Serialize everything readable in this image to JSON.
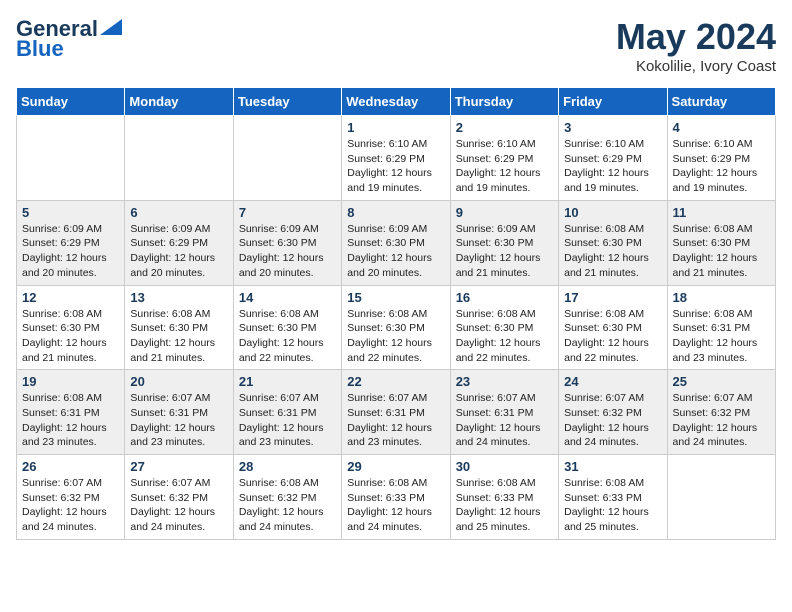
{
  "header": {
    "logo_line1": "General",
    "logo_line2": "Blue",
    "month": "May 2024",
    "location": "Kokolilie, Ivory Coast"
  },
  "weekdays": [
    "Sunday",
    "Monday",
    "Tuesday",
    "Wednesday",
    "Thursday",
    "Friday",
    "Saturday"
  ],
  "weeks": [
    [
      {
        "day": "",
        "info": ""
      },
      {
        "day": "",
        "info": ""
      },
      {
        "day": "",
        "info": ""
      },
      {
        "day": "1",
        "info": "Sunrise: 6:10 AM\nSunset: 6:29 PM\nDaylight: 12 hours and 19 minutes."
      },
      {
        "day": "2",
        "info": "Sunrise: 6:10 AM\nSunset: 6:29 PM\nDaylight: 12 hours and 19 minutes."
      },
      {
        "day": "3",
        "info": "Sunrise: 6:10 AM\nSunset: 6:29 PM\nDaylight: 12 hours and 19 minutes."
      },
      {
        "day": "4",
        "info": "Sunrise: 6:10 AM\nSunset: 6:29 PM\nDaylight: 12 hours and 19 minutes."
      }
    ],
    [
      {
        "day": "5",
        "info": "Sunrise: 6:09 AM\nSunset: 6:29 PM\nDaylight: 12 hours and 20 minutes."
      },
      {
        "day": "6",
        "info": "Sunrise: 6:09 AM\nSunset: 6:29 PM\nDaylight: 12 hours and 20 minutes."
      },
      {
        "day": "7",
        "info": "Sunrise: 6:09 AM\nSunset: 6:30 PM\nDaylight: 12 hours and 20 minutes."
      },
      {
        "day": "8",
        "info": "Sunrise: 6:09 AM\nSunset: 6:30 PM\nDaylight: 12 hours and 20 minutes."
      },
      {
        "day": "9",
        "info": "Sunrise: 6:09 AM\nSunset: 6:30 PM\nDaylight: 12 hours and 21 minutes."
      },
      {
        "day": "10",
        "info": "Sunrise: 6:08 AM\nSunset: 6:30 PM\nDaylight: 12 hours and 21 minutes."
      },
      {
        "day": "11",
        "info": "Sunrise: 6:08 AM\nSunset: 6:30 PM\nDaylight: 12 hours and 21 minutes."
      }
    ],
    [
      {
        "day": "12",
        "info": "Sunrise: 6:08 AM\nSunset: 6:30 PM\nDaylight: 12 hours and 21 minutes."
      },
      {
        "day": "13",
        "info": "Sunrise: 6:08 AM\nSunset: 6:30 PM\nDaylight: 12 hours and 21 minutes."
      },
      {
        "day": "14",
        "info": "Sunrise: 6:08 AM\nSunset: 6:30 PM\nDaylight: 12 hours and 22 minutes."
      },
      {
        "day": "15",
        "info": "Sunrise: 6:08 AM\nSunset: 6:30 PM\nDaylight: 12 hours and 22 minutes."
      },
      {
        "day": "16",
        "info": "Sunrise: 6:08 AM\nSunset: 6:30 PM\nDaylight: 12 hours and 22 minutes."
      },
      {
        "day": "17",
        "info": "Sunrise: 6:08 AM\nSunset: 6:30 PM\nDaylight: 12 hours and 22 minutes."
      },
      {
        "day": "18",
        "info": "Sunrise: 6:08 AM\nSunset: 6:31 PM\nDaylight: 12 hours and 23 minutes."
      }
    ],
    [
      {
        "day": "19",
        "info": "Sunrise: 6:08 AM\nSunset: 6:31 PM\nDaylight: 12 hours and 23 minutes."
      },
      {
        "day": "20",
        "info": "Sunrise: 6:07 AM\nSunset: 6:31 PM\nDaylight: 12 hours and 23 minutes."
      },
      {
        "day": "21",
        "info": "Sunrise: 6:07 AM\nSunset: 6:31 PM\nDaylight: 12 hours and 23 minutes."
      },
      {
        "day": "22",
        "info": "Sunrise: 6:07 AM\nSunset: 6:31 PM\nDaylight: 12 hours and 23 minutes."
      },
      {
        "day": "23",
        "info": "Sunrise: 6:07 AM\nSunset: 6:31 PM\nDaylight: 12 hours and 24 minutes."
      },
      {
        "day": "24",
        "info": "Sunrise: 6:07 AM\nSunset: 6:32 PM\nDaylight: 12 hours and 24 minutes."
      },
      {
        "day": "25",
        "info": "Sunrise: 6:07 AM\nSunset: 6:32 PM\nDaylight: 12 hours and 24 minutes."
      }
    ],
    [
      {
        "day": "26",
        "info": "Sunrise: 6:07 AM\nSunset: 6:32 PM\nDaylight: 12 hours and 24 minutes."
      },
      {
        "day": "27",
        "info": "Sunrise: 6:07 AM\nSunset: 6:32 PM\nDaylight: 12 hours and 24 minutes."
      },
      {
        "day": "28",
        "info": "Sunrise: 6:08 AM\nSunset: 6:32 PM\nDaylight: 12 hours and 24 minutes."
      },
      {
        "day": "29",
        "info": "Sunrise: 6:08 AM\nSunset: 6:33 PM\nDaylight: 12 hours and 24 minutes."
      },
      {
        "day": "30",
        "info": "Sunrise: 6:08 AM\nSunset: 6:33 PM\nDaylight: 12 hours and 25 minutes."
      },
      {
        "day": "31",
        "info": "Sunrise: 6:08 AM\nSunset: 6:33 PM\nDaylight: 12 hours and 25 minutes."
      },
      {
        "day": "",
        "info": ""
      }
    ]
  ]
}
